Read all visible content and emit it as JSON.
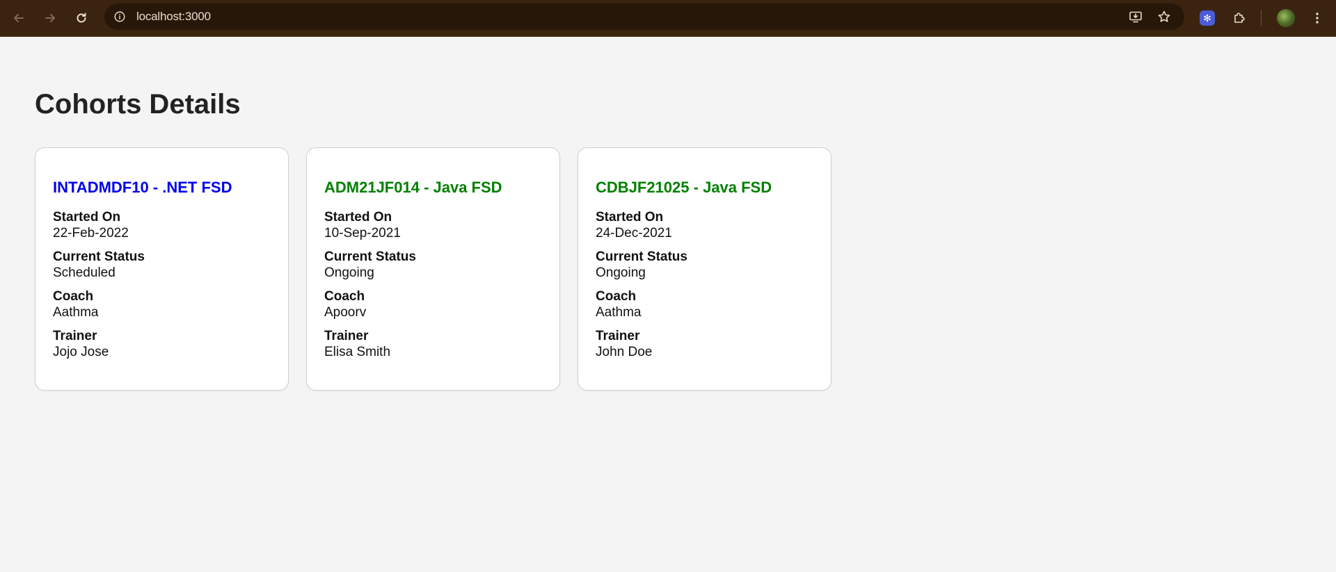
{
  "browser": {
    "url": "localhost:3000"
  },
  "page": {
    "title": "Cohorts Details"
  },
  "cohorts": [
    {
      "title": "INTADMDF10 - .NET FSD",
      "title_color": "#0000ee",
      "started_label": "Started On",
      "started_value": "22-Feb-2022",
      "status_label": "Current Status",
      "status_value": "Scheduled",
      "coach_label": "Coach",
      "coach_value": "Aathma",
      "trainer_label": "Trainer",
      "trainer_value": "Jojo Jose"
    },
    {
      "title": "ADM21JF014 - Java FSD",
      "title_color": "#008000",
      "started_label": "Started On",
      "started_value": "10-Sep-2021",
      "status_label": "Current Status",
      "status_value": "Ongoing",
      "coach_label": "Coach",
      "coach_value": "Apoorv",
      "trainer_label": "Trainer",
      "trainer_value": "Elisa Smith"
    },
    {
      "title": "CDBJF21025 - Java FSD",
      "title_color": "#008000",
      "started_label": "Started On",
      "started_value": "24-Dec-2021",
      "status_label": "Current Status",
      "status_value": "Ongoing",
      "coach_label": "Coach",
      "coach_value": "Aathma",
      "trainer_label": "Trainer",
      "trainer_value": "John Doe"
    }
  ],
  "icons": {
    "back": "arrow-left-icon",
    "forward": "arrow-right-icon",
    "reload": "reload-icon",
    "site_info": "info-icon",
    "install": "install-app-icon",
    "bookmark": "star-icon",
    "extension": "extension-badge-icon",
    "extensions": "puzzle-icon",
    "profile": "avatar",
    "menu": "kebab-menu-icon"
  }
}
